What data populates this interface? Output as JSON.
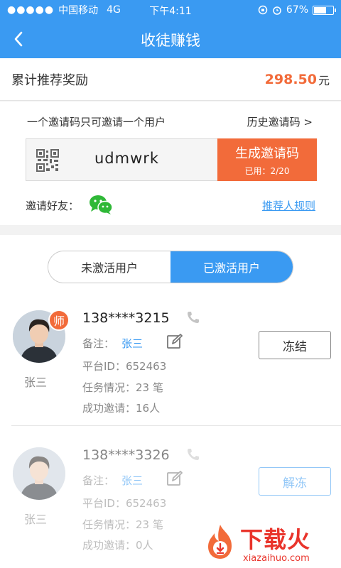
{
  "status_bar": {
    "signal": "●●●●●",
    "carrier": "中国移动",
    "network": "4G",
    "time": "下午4:11",
    "battery": "67%",
    "battery_level": 0.67
  },
  "nav": {
    "title": "收徒赚钱",
    "back_icon": "chevron-left-icon"
  },
  "reward": {
    "label": "累计推荐奖励",
    "amount": "298.50",
    "unit": "元"
  },
  "invite": {
    "hint": "一个邀请码只可邀请一个用户",
    "history_link": "历史邀请码 >",
    "code": "udmwrk",
    "generate_button": "生成邀请码",
    "used": "已用：2/20",
    "friends_label": "邀请好友：",
    "rules_link": "推荐人规则"
  },
  "tabs": [
    {
      "label": "未激活用户",
      "active": false
    },
    {
      "label": "已激活用户",
      "active": true
    }
  ],
  "users": [
    {
      "badge": "师",
      "name": "张三",
      "phone": "138****3215",
      "remark_label": "备注：",
      "remark_value": "张三",
      "platform_id": "平台ID：652463",
      "tasks": "任务情况：23  笔",
      "invites": "成功邀请：16人",
      "action": "冻结"
    },
    {
      "name": "张三",
      "phone": "138****3326",
      "remark_label": "备注：",
      "remark_value": "张三",
      "platform_id": "平台ID：652463",
      "tasks": "任务情况：23  笔",
      "invites": "成功邀请：0人",
      "action": "解冻"
    }
  ],
  "watermark": {
    "title": "下载火",
    "url": "xiazaihuo.com"
  },
  "colors": {
    "primary": "#3a9af2",
    "accent": "#f26b3a",
    "wechat": "#2fb837"
  }
}
